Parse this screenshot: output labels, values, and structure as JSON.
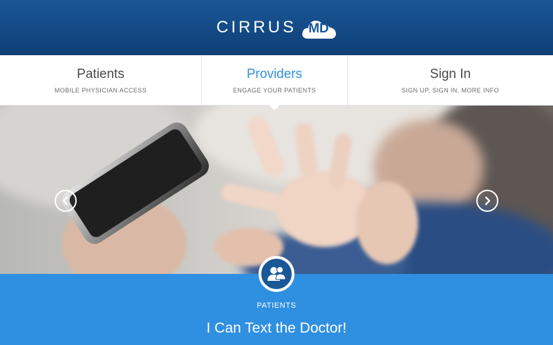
{
  "header": {
    "logo_text": "CIRRUS",
    "logo_badge": "MD"
  },
  "nav": {
    "items": [
      {
        "title": "Patients",
        "subtitle": "MOBILE PHYSICIAN ACCESS"
      },
      {
        "title": "Providers",
        "subtitle": "ENGAGE YOUR PATIENTS"
      },
      {
        "title": "Sign In",
        "subtitle": "SIGN UP, SIGN IN, MORE INFO"
      }
    ],
    "active_color": "#2f92dc"
  },
  "hero": {
    "prev_icon": "chevron-left-icon",
    "next_icon": "chevron-right-icon"
  },
  "feature": {
    "icon": "people-icon",
    "label": "PATIENTS",
    "headline": "I Can Text the Doctor!"
  },
  "colors": {
    "header_bg": "#1a5796",
    "band_bg": "#2f8fe0",
    "accent": "#2f92dc"
  }
}
